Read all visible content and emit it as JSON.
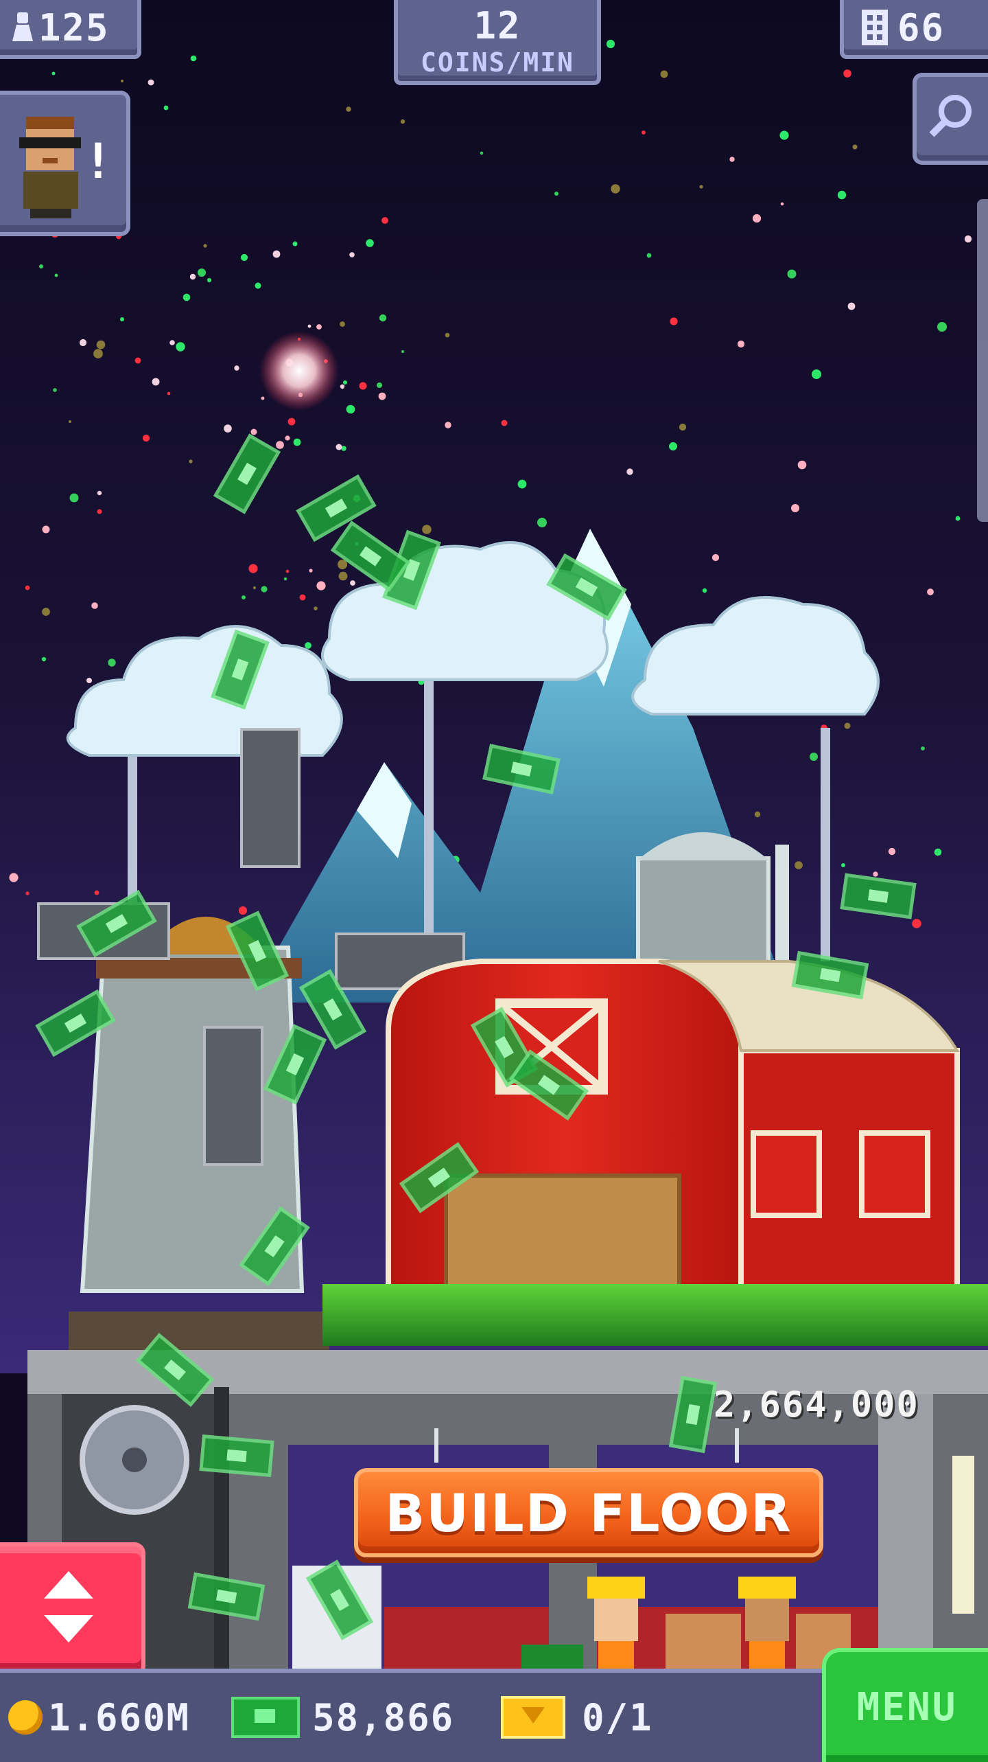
{
  "hud": {
    "population": "125",
    "coins_rate": "12",
    "coins_rate_unit": "COINS/MIN",
    "floors": "66"
  },
  "lobby": {
    "floor_cost": "2,664,000",
    "build_label": "BUILD FLOOR"
  },
  "bottom_bar": {
    "coins": "1.660M",
    "tower_bux": "58,866",
    "tickets": "0/1",
    "menu_label": "MENU"
  },
  "colors": {
    "hud_panel": "#5f648f",
    "build_button": "#f4641c",
    "elevator_button": "#ff3a5c",
    "menu_button": "#2ac43d",
    "barn": "#d8231c"
  },
  "icons": [
    "people-icon",
    "floors-icon",
    "search-icon",
    "vip-avatar",
    "elevator-arrows-icon",
    "coin-icon",
    "bux-icon",
    "ticket-icon"
  ]
}
